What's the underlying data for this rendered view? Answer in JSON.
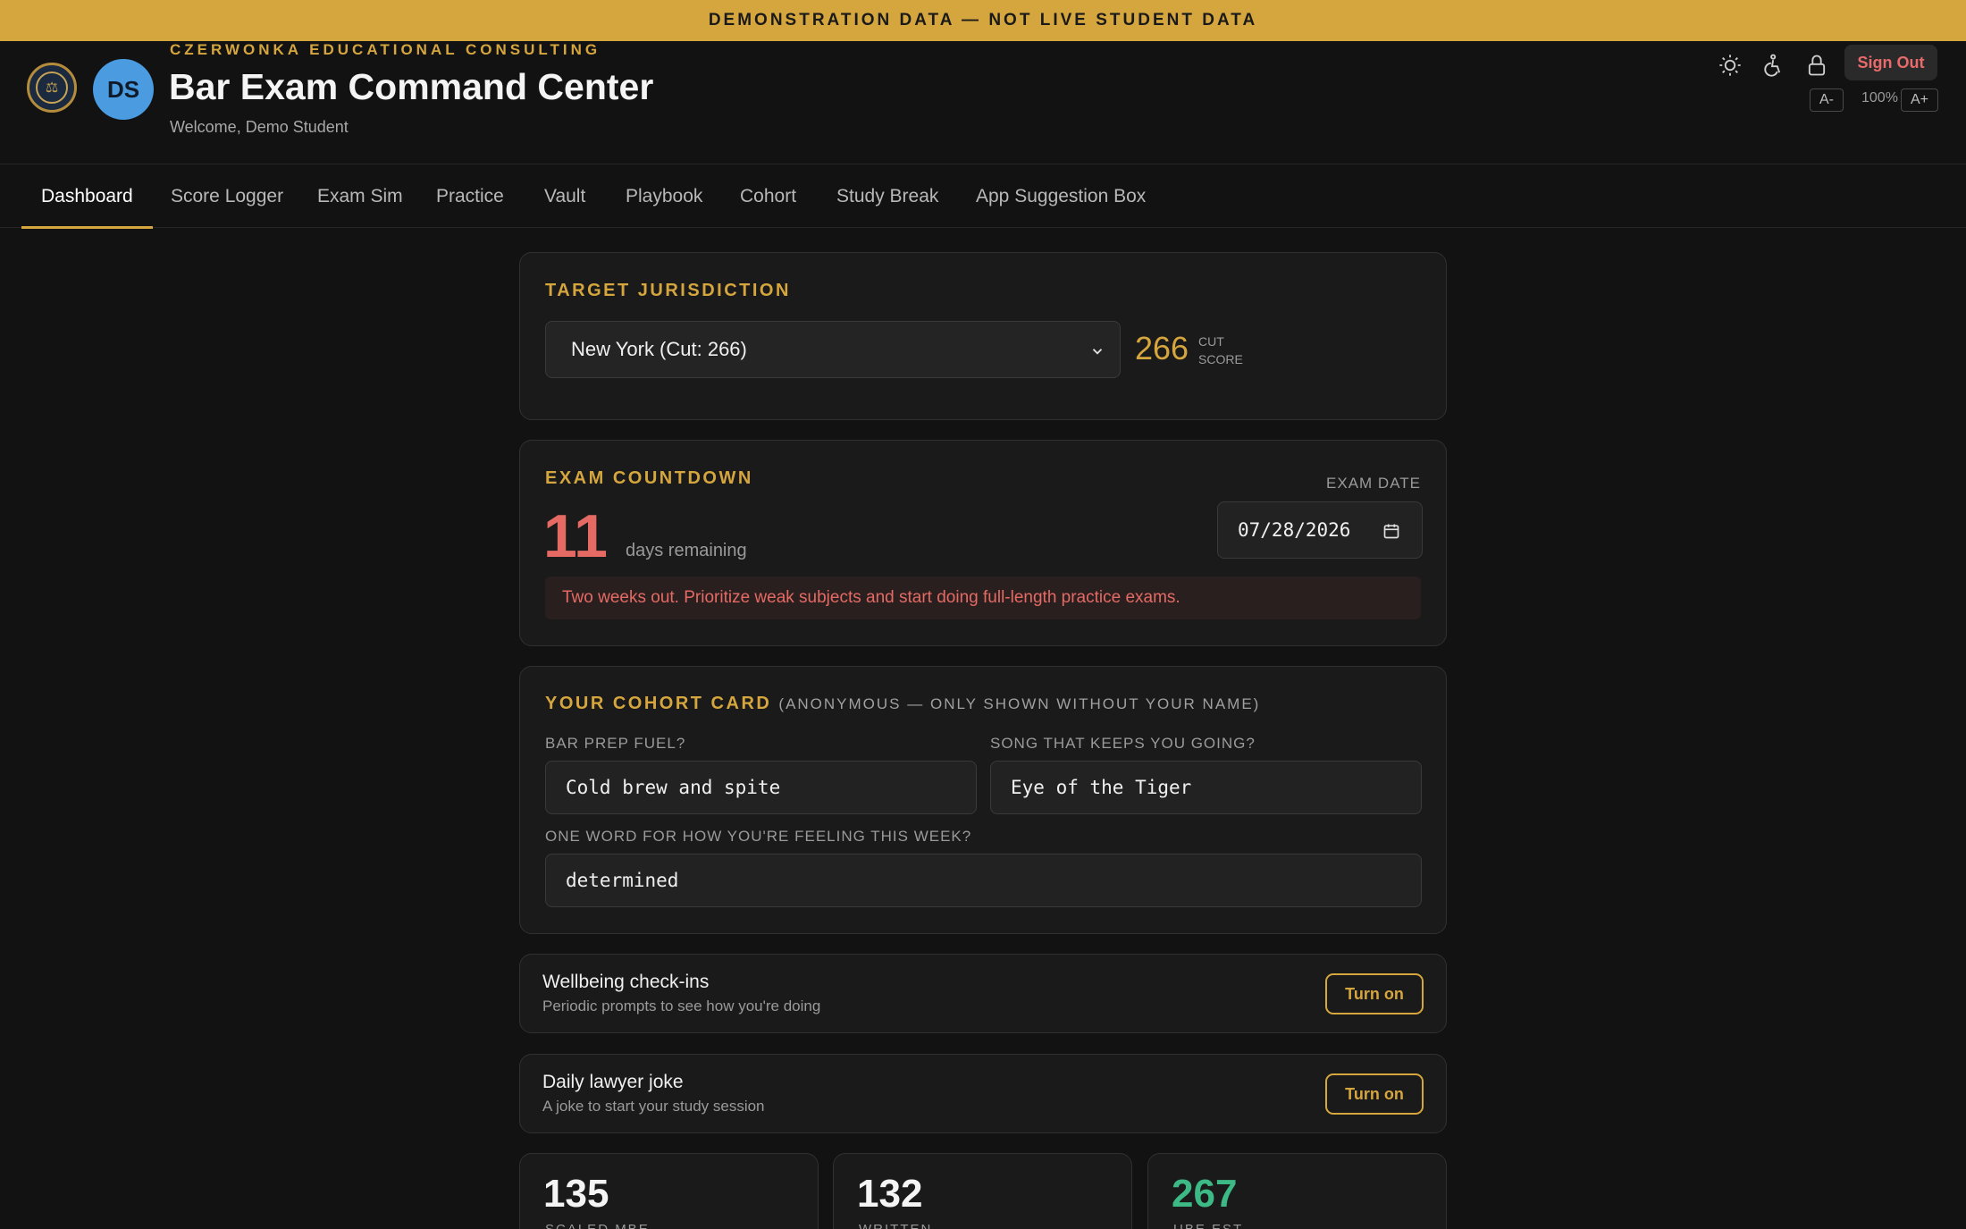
{
  "banner": "DEMONSTRATION DATA — NOT LIVE STUDENT DATA",
  "header": {
    "org": "CZERWONKA EDUCATIONAL CONSULTING",
    "title": "Bar Exam Command Center",
    "welcome": "Welcome, Demo Student",
    "avatar_initials": "DS",
    "sign_out": "Sign Out",
    "zoom_decrease": "A-",
    "zoom_level": "100%",
    "zoom_increase": "A+"
  },
  "nav": {
    "tabs": [
      "Dashboard",
      "Score Logger",
      "Exam Sim",
      "Practice",
      "Vault",
      "Playbook",
      "Cohort",
      "Study Break",
      "App Suggestion Box"
    ],
    "active": "Dashboard"
  },
  "jurisdiction": {
    "label": "TARGET JURISDICTION",
    "selected": "New York (Cut: 266)",
    "cut_score": "266",
    "cut_label_1": "CUT",
    "cut_label_2": "SCORE"
  },
  "countdown": {
    "label": "EXAM COUNTDOWN",
    "days": "11",
    "days_label": "days remaining",
    "exam_date_label": "EXAM DATE",
    "exam_date": "07/28/2026",
    "alert": "Two weeks out. Prioritize weak subjects and start doing full-length practice exams."
  },
  "cohort_card": {
    "label": "YOUR COHORT CARD",
    "note": "(ANONYMOUS — ONLY SHOWN WITHOUT YOUR NAME)",
    "fuel_label": "BAR PREP FUEL?",
    "fuel_value": "Cold brew and spite",
    "song_label": "SONG THAT KEEPS YOU GOING?",
    "song_value": "Eye of the Tiger",
    "feeling_label": "ONE WORD FOR HOW YOU'RE FEELING THIS WEEK?",
    "feeling_value": "determined"
  },
  "toggles": [
    {
      "title": "Wellbeing check-ins",
      "subtitle": "Periodic prompts to see how you're doing",
      "button": "Turn on"
    },
    {
      "title": "Daily lawyer joke",
      "subtitle": "A joke to start your study session",
      "button": "Turn on"
    }
  ],
  "stats": [
    {
      "value": "135",
      "label": "SCALED MBE"
    },
    {
      "value": "132",
      "label": "WRITTEN"
    },
    {
      "value": "267",
      "label": "UBE EST."
    }
  ],
  "colors": {
    "accent": "#d6a63e",
    "danger": "#e56a64",
    "success": "#3cb985",
    "avatar": "#4a9be0"
  }
}
